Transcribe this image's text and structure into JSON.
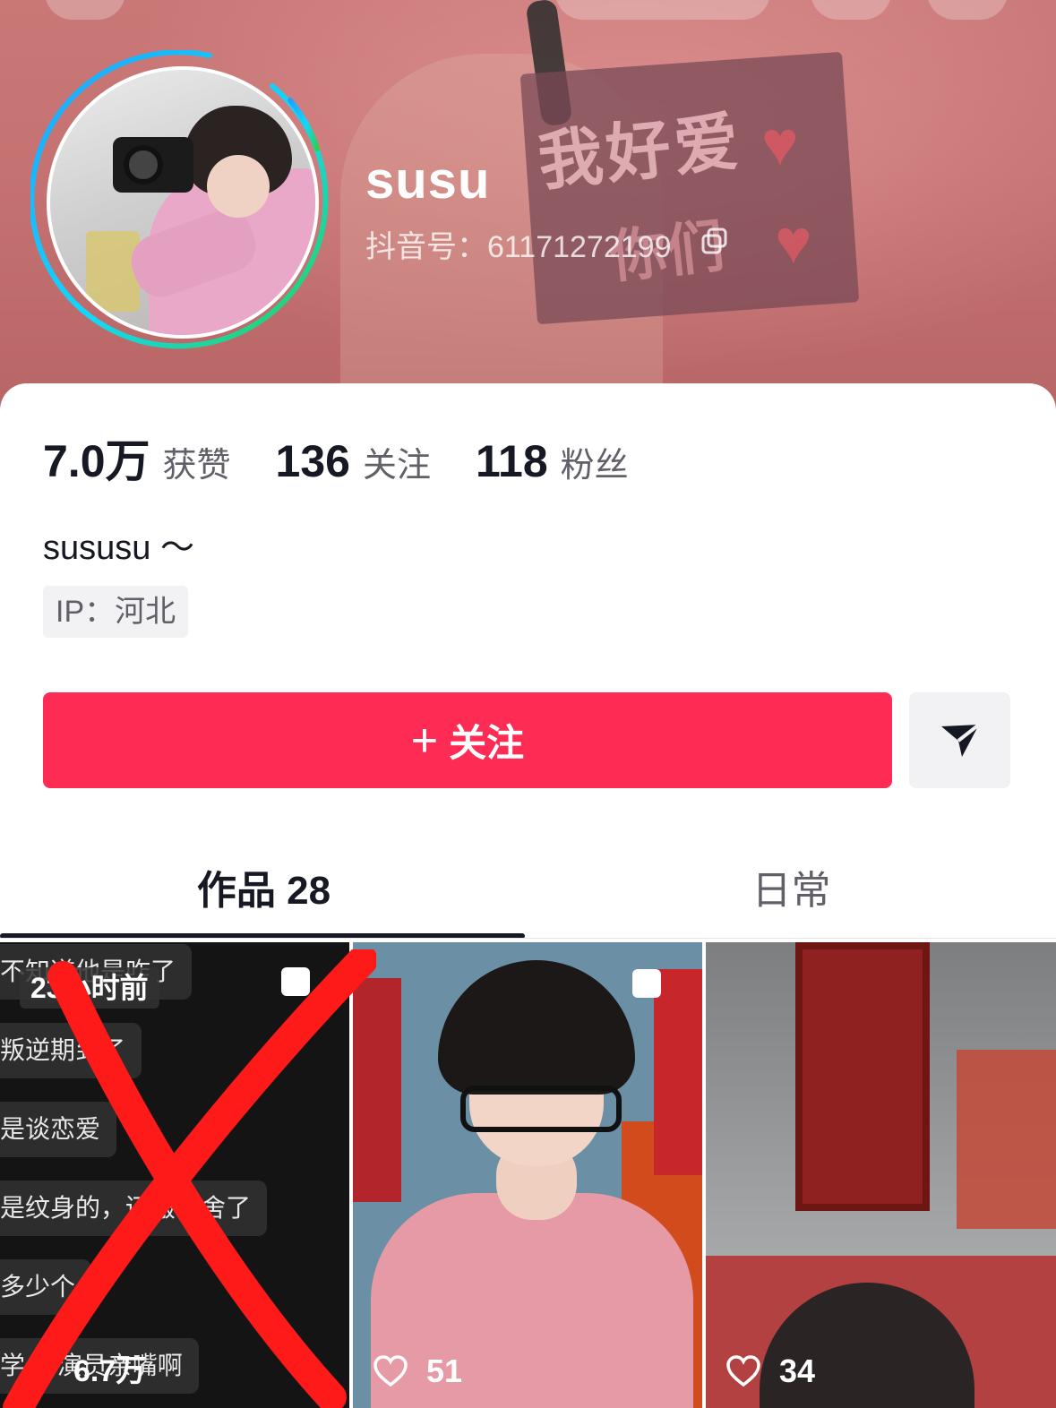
{
  "profile": {
    "username": "susu",
    "douyin_id": "抖音号：61171272199",
    "bio": "sususu ～",
    "ip": "IP：河北"
  },
  "stats": [
    {
      "num": "7.0万",
      "label": "获赞"
    },
    {
      "num": "136",
      "label": "关注"
    },
    {
      "num": "118",
      "label": "粉丝"
    }
  ],
  "actions": {
    "follow_plus": "+",
    "follow_label": "关注"
  },
  "tabs": {
    "works": "作品 28",
    "daily": "日常"
  },
  "banner": {
    "sign_line1": "我好爱",
    "sign_line2": "你们"
  },
  "videos": [
    {
      "time_badge": "23小时前",
      "views": "6.7万",
      "chat_lines": [
        "不知道他是咋了",
        "叛逆期到了",
        "是谈恋爱",
        "是纹身的，还搬出舍了",
        "多少个",
        "学 当演员亲嘴啊"
      ]
    },
    {
      "likes": "51"
    },
    {
      "likes": "34"
    }
  ],
  "colors": {
    "accent": "#fe2c55",
    "text_primary": "#161823",
    "text_secondary": "#5f6068"
  }
}
